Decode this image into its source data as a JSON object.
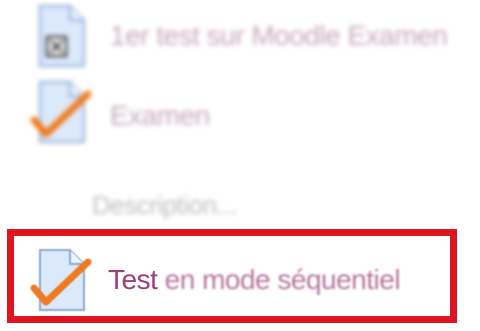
{
  "activities": [
    {
      "icon": "quiz-cross-document-icon",
      "label": "1er test sur Moodle Examen"
    },
    {
      "icon": "checkmark-document-icon",
      "label": "Examen",
      "description": "Description..."
    },
    {
      "icon": "checkmark-document-icon",
      "label_first": "Test",
      "label_rest": " en mode séquentiel"
    }
  ],
  "colors": {
    "highlight": "#e0141f",
    "link": "#9c3d7d",
    "checkmark": "#f07b1e",
    "document": "#dce9fb"
  }
}
